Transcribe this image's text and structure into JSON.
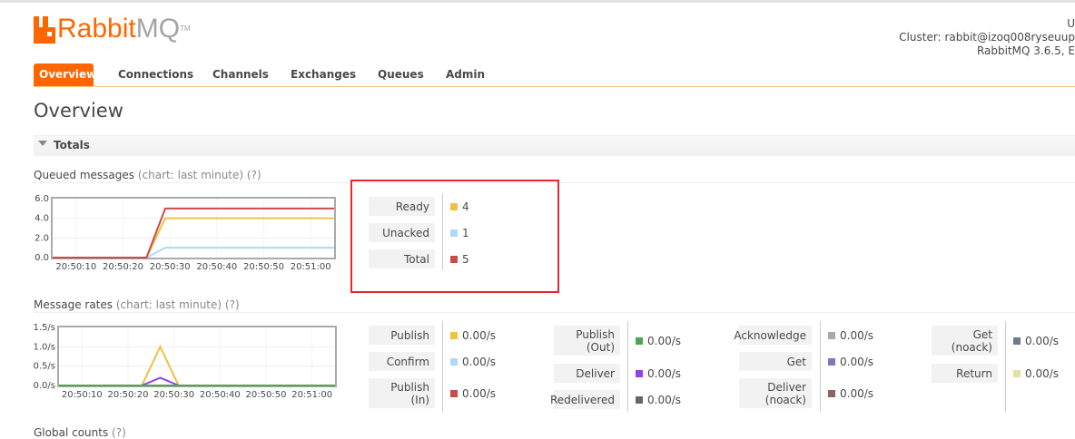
{
  "header": {
    "logo_rabbit": "Rabbit",
    "logo_mq": "MQ",
    "logo_tm": "TM",
    "user_partial": "U",
    "cluster_label": "Cluster:",
    "cluster_value": "rabbit@izoq008ryseuup",
    "version": "RabbitMQ 3.6.5, E"
  },
  "nav": {
    "items": [
      "Overview",
      "Connections",
      "Channels",
      "Exchanges",
      "Queues",
      "Admin"
    ],
    "active": "Overview"
  },
  "page": {
    "title": "Overview"
  },
  "totals": {
    "section_label": "Totals",
    "queued": {
      "title": "Queued messages",
      "chart_hint": "(chart: last minute)",
      "help": "(?)",
      "legend": [
        {
          "label": "Ready",
          "value": "4",
          "color": "#edc240"
        },
        {
          "label": "Unacked",
          "value": "1",
          "color": "#afd8f8"
        },
        {
          "label": "Total",
          "value": "5",
          "color": "#cb4b4b"
        }
      ]
    },
    "rates": {
      "title": "Message rates",
      "chart_hint": "(chart: last minute)",
      "help": "(?)",
      "legend": [
        {
          "label": "Publish",
          "value": "0.00/s",
          "color": "#edc240"
        },
        {
          "label": "Confirm",
          "value": "0.00/s",
          "color": "#afd8f8"
        },
        {
          "label": "Publish\n(In)",
          "value": "0.00/s",
          "color": "#cb4b4b"
        },
        {
          "label": "Publish\n(Out)",
          "value": "0.00/s",
          "color": "#4da74d"
        },
        {
          "label": "Deliver",
          "value": "0.00/s",
          "color": "#9440ed"
        },
        {
          "label": "Redelivered",
          "value": "0.00/s",
          "color": "#666666"
        },
        {
          "label": "Acknowledge",
          "value": "0.00/s",
          "color": "#aaaaaa"
        },
        {
          "label": "Get",
          "value": "0.00/s",
          "color": "#7c79c3"
        },
        {
          "label": "Deliver\n(noack)",
          "value": "0.00/s",
          "color": "#8d6363"
        },
        {
          "label": "Get\n(noack)",
          "value": "0.00/s",
          "color": "#6b7b8c"
        },
        {
          "label": "Return",
          "value": "0.00/s",
          "color": "#e1e1a1"
        }
      ]
    },
    "global_counts": {
      "title": "Global counts",
      "help": "(?)"
    }
  },
  "chart_data": [
    {
      "type": "line",
      "title": "Queued messages",
      "x": [
        "20:50:10",
        "20:50:20",
        "20:50:30",
        "20:50:40",
        "20:50:50",
        "20:51:00"
      ],
      "xlim_seconds": [
        5,
        65
      ],
      "ylim": [
        0,
        6
      ],
      "yticks": [
        "0.0",
        "2.0",
        "4.0",
        "6.0"
      ],
      "series": [
        {
          "name": "Ready",
          "color": "#edc240",
          "points": [
            [
              5,
              0
            ],
            [
              25,
              0
            ],
            [
              29,
              4
            ],
            [
              65,
              4
            ]
          ]
        },
        {
          "name": "Unacked",
          "color": "#afd8f8",
          "points": [
            [
              5,
              0
            ],
            [
              25,
              0
            ],
            [
              29,
              1
            ],
            [
              65,
              1
            ]
          ]
        },
        {
          "name": "Total",
          "color": "#cb4b4b",
          "points": [
            [
              5,
              0
            ],
            [
              25,
              0
            ],
            [
              29,
              5
            ],
            [
              65,
              5
            ]
          ]
        }
      ]
    },
    {
      "type": "line",
      "title": "Message rates",
      "x": [
        "20:50:10",
        "20:50:20",
        "20:50:30",
        "20:50:40",
        "20:50:50",
        "20:51:00"
      ],
      "xlim_seconds": [
        5,
        65
      ],
      "ylim": [
        0,
        1.5
      ],
      "yticks": [
        "0.0/s",
        "0.5/s",
        "1.0/s",
        "1.5/s"
      ],
      "series": [
        {
          "name": "Publish",
          "color": "#edc240",
          "points": [
            [
              5,
              0
            ],
            [
              23,
              0
            ],
            [
              27,
              1.0
            ],
            [
              31,
              0
            ],
            [
              65,
              0
            ]
          ]
        },
        {
          "name": "Deliver",
          "color": "#9440ed",
          "points": [
            [
              5,
              0
            ],
            [
              23,
              0
            ],
            [
              27,
              0.2
            ],
            [
              31,
              0
            ],
            [
              65,
              0
            ]
          ]
        },
        {
          "name": "Confirm",
          "color": "#afd8f8",
          "points": [
            [
              5,
              0
            ],
            [
              65,
              0
            ]
          ]
        },
        {
          "name": "Publish (Out)",
          "color": "#4da74d",
          "points": [
            [
              5,
              0
            ],
            [
              65,
              0
            ]
          ]
        }
      ]
    }
  ]
}
